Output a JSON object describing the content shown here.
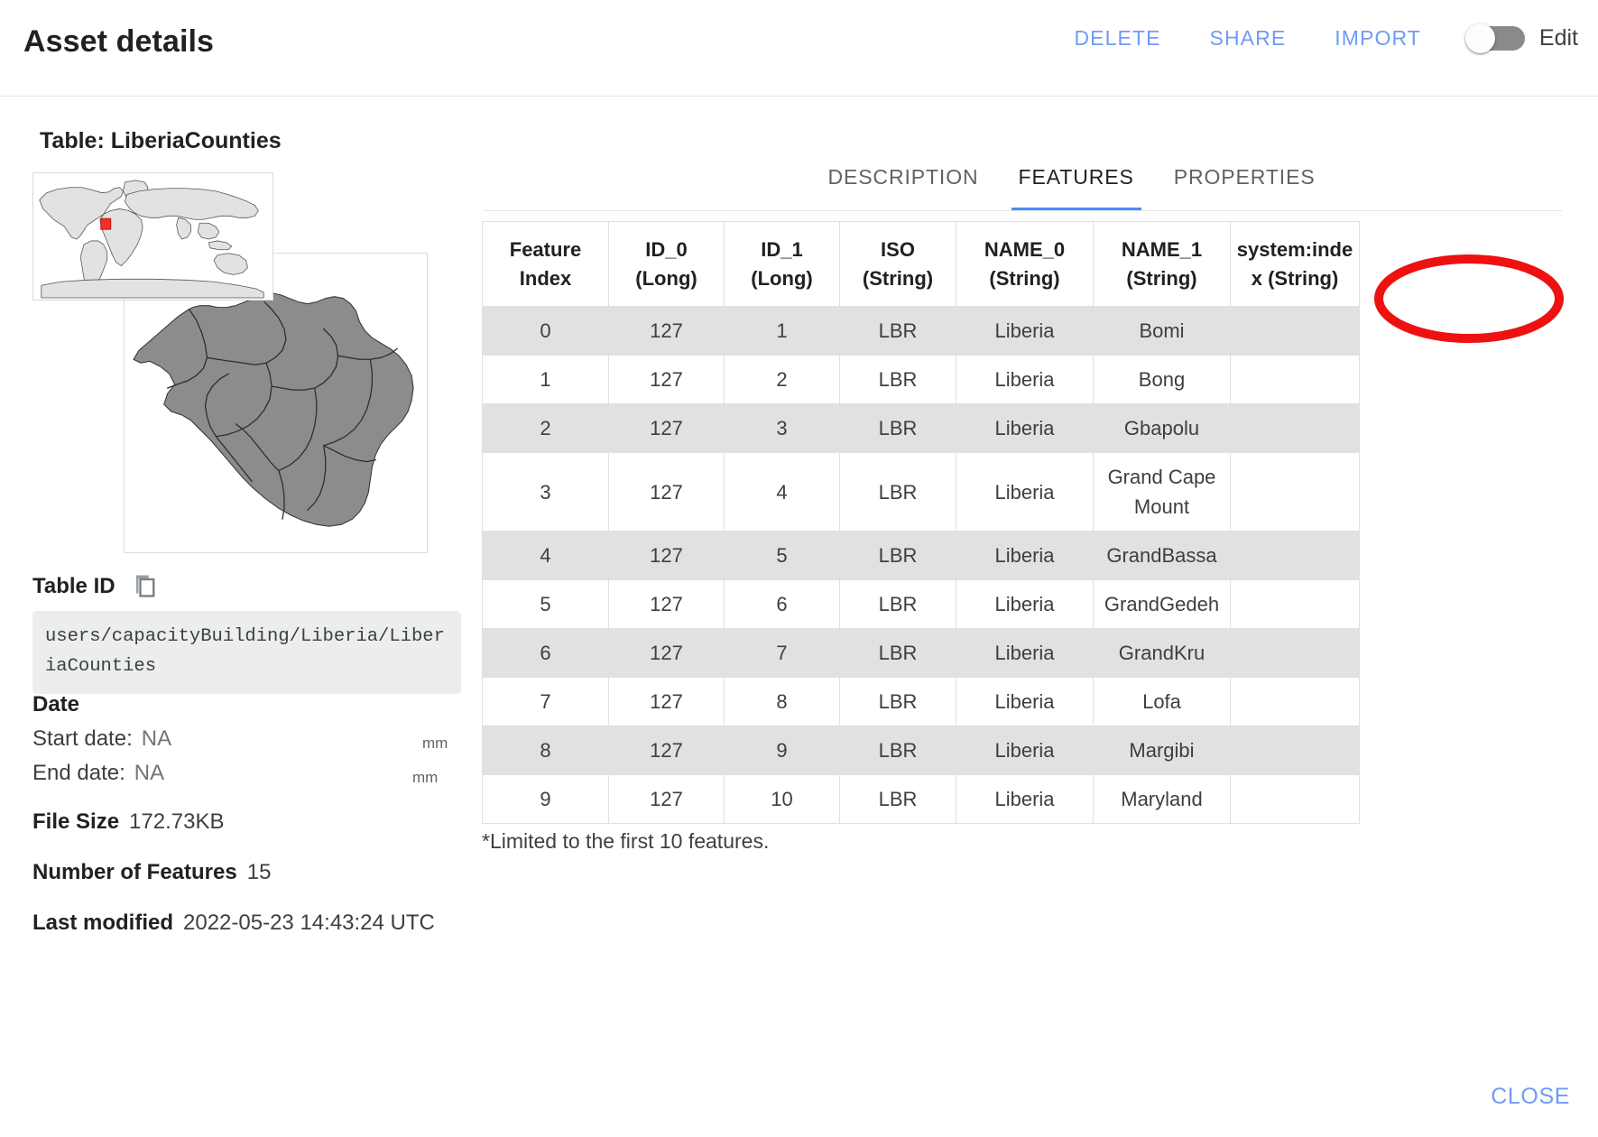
{
  "header": {
    "title": "Asset details",
    "actions": [
      {
        "label": "DELETE",
        "name": "delete-button"
      },
      {
        "label": "SHARE",
        "name": "share-button"
      },
      {
        "label": "IMPORT",
        "name": "import-button"
      }
    ],
    "edit_toggle_label": "Edit",
    "edit_toggle_state": "off",
    "link_color": "#6f9bf5"
  },
  "asset": {
    "table_name": "Table: LiberiaCounties",
    "table_id_label": "Table ID",
    "table_id_value": "users/capacityBuilding/Liberia/LiberiaCounties",
    "date_label": "Date",
    "start_date_label": "Start date:",
    "start_date_value": "NA",
    "start_date_hint": "mm",
    "end_date_label": "End date:",
    "end_date_value": "NA",
    "end_date_hint": "mm",
    "file_size_label": "File Size",
    "file_size_value": "172.73KB",
    "num_features_label": "Number of Features",
    "num_features_value": "15",
    "last_modified_label": "Last modified",
    "last_modified_value": "2022-05-23 14:43:24 UTC"
  },
  "tabs": [
    {
      "label": "DESCRIPTION",
      "name": "tab-description",
      "active": false
    },
    {
      "label": "FEATURES",
      "name": "tab-features",
      "active": true
    },
    {
      "label": "PROPERTIES",
      "name": "tab-properties",
      "active": false
    }
  ],
  "annotation": {
    "shape": "ellipse",
    "color": "#ee1111",
    "target": "FEATURES"
  },
  "features_table": {
    "columns": [
      "Feature Index",
      "ID_0 (Long)",
      "ID_1 (Long)",
      "ISO (String)",
      "NAME_0 (String)",
      "NAME_1 (String)",
      "system:index (String)"
    ],
    "columns_display": [
      [
        "Feature",
        "Index"
      ],
      [
        "ID_0",
        "(Long)"
      ],
      [
        "ID_1",
        "(Long)"
      ],
      [
        "ISO",
        "(String)"
      ],
      [
        "NAME_0",
        "(String)"
      ],
      [
        "NAME_1",
        "(String)"
      ],
      [
        "system:inde",
        "x (String)"
      ]
    ],
    "rows": [
      [
        "0",
        "127",
        "1",
        "LBR",
        "Liberia",
        "Bomi",
        ""
      ],
      [
        "1",
        "127",
        "2",
        "LBR",
        "Liberia",
        "Bong",
        ""
      ],
      [
        "2",
        "127",
        "3",
        "LBR",
        "Liberia",
        "Gbapolu",
        ""
      ],
      [
        "3",
        "127",
        "4",
        "LBR",
        "Liberia",
        "Grand Cape Mount",
        ""
      ],
      [
        "4",
        "127",
        "5",
        "LBR",
        "Liberia",
        "GrandBassa",
        ""
      ],
      [
        "5",
        "127",
        "6",
        "LBR",
        "Liberia",
        "GrandGedeh",
        ""
      ],
      [
        "6",
        "127",
        "7",
        "LBR",
        "Liberia",
        "GrandKru",
        ""
      ],
      [
        "7",
        "127",
        "8",
        "LBR",
        "Liberia",
        "Lofa",
        ""
      ],
      [
        "8",
        "127",
        "9",
        "LBR",
        "Liberia",
        "Margibi",
        ""
      ],
      [
        "9",
        "127",
        "10",
        "LBR",
        "Liberia",
        "Maryland",
        ""
      ]
    ],
    "note": "*Limited to the first 10 features."
  },
  "footer": {
    "close_label": "CLOSE"
  }
}
